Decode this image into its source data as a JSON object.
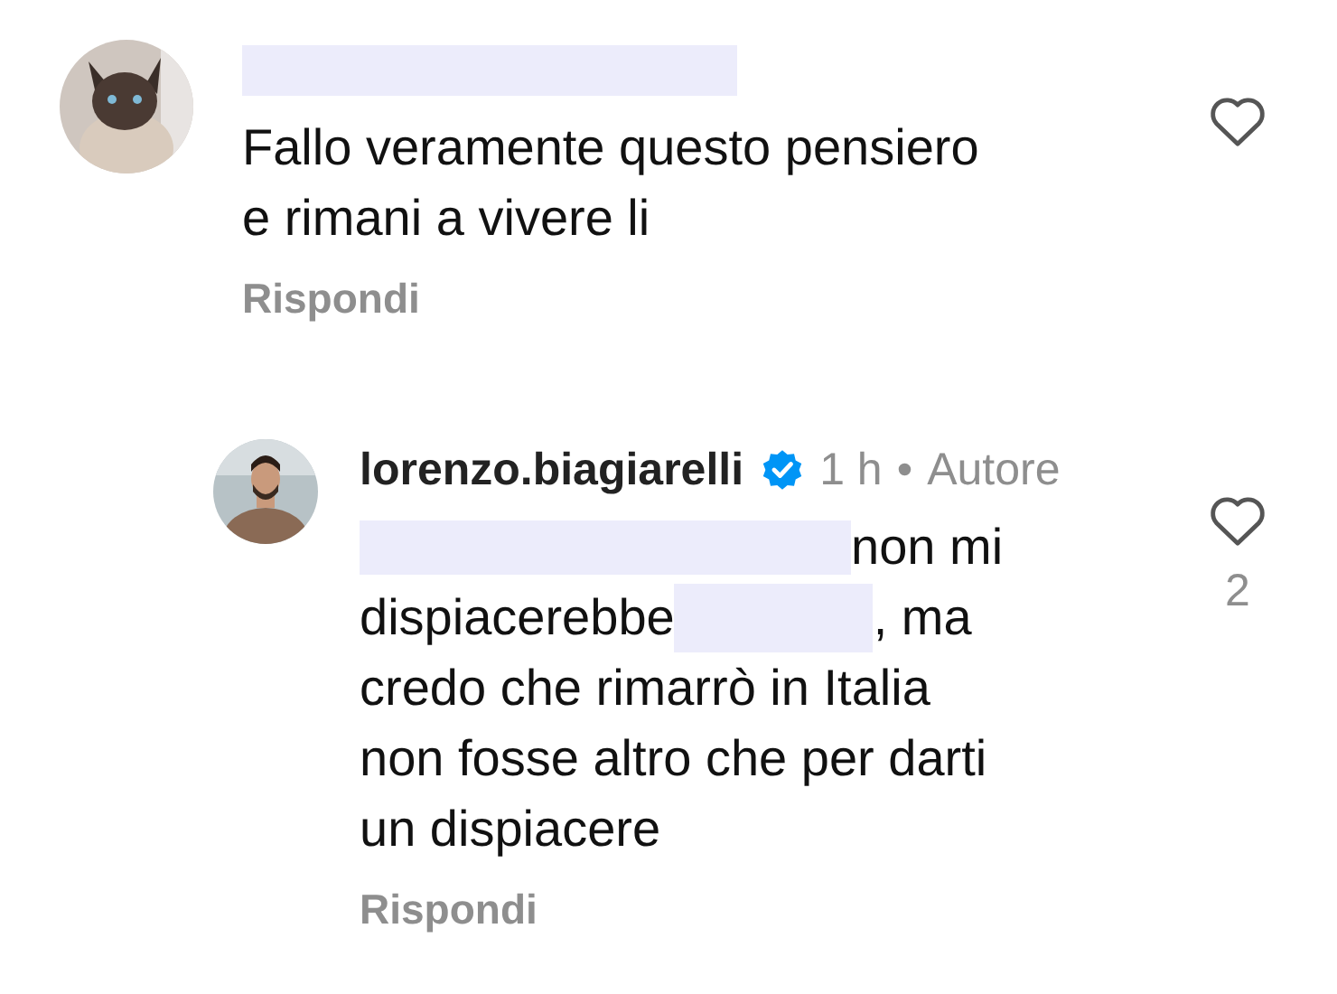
{
  "comments": [
    {
      "author": {
        "kind": "redaction"
      },
      "avatar": {
        "kind": "cat"
      },
      "lines": [
        [
          {
            "kind": "text",
            "text": "Fallo veramente questo pensiero"
          }
        ],
        [
          {
            "kind": "text",
            "text": "e rimani a vivere li"
          }
        ]
      ],
      "reply_label": "Rispondi",
      "liked": false,
      "verified": false,
      "replies": [
        {
          "author": {
            "kind": "name",
            "text": "lorenzo.biagiarelli"
          },
          "verified": true,
          "time": "1 h",
          "separator": "•",
          "role": "Autore",
          "avatar": {
            "kind": "person"
          },
          "lines": [
            [
              {
                "kind": "redaction"
              },
              {
                "kind": "text",
                "text": "non mi"
              }
            ],
            [
              {
                "kind": "text",
                "text": "dispiacerebbe"
              },
              {
                "kind": "redaction"
              },
              {
                "kind": "text",
                "text": ", ma"
              }
            ],
            [
              {
                "kind": "text",
                "text": "credo che rimarrò in Italia"
              }
            ],
            [
              {
                "kind": "text",
                "text": "non fosse altro che per darti"
              }
            ],
            [
              {
                "kind": "text",
                "text": "un dispiacere"
              }
            ]
          ],
          "reply_label": "Rispondi",
          "liked": false,
          "like_count": "2"
        }
      ]
    }
  ]
}
